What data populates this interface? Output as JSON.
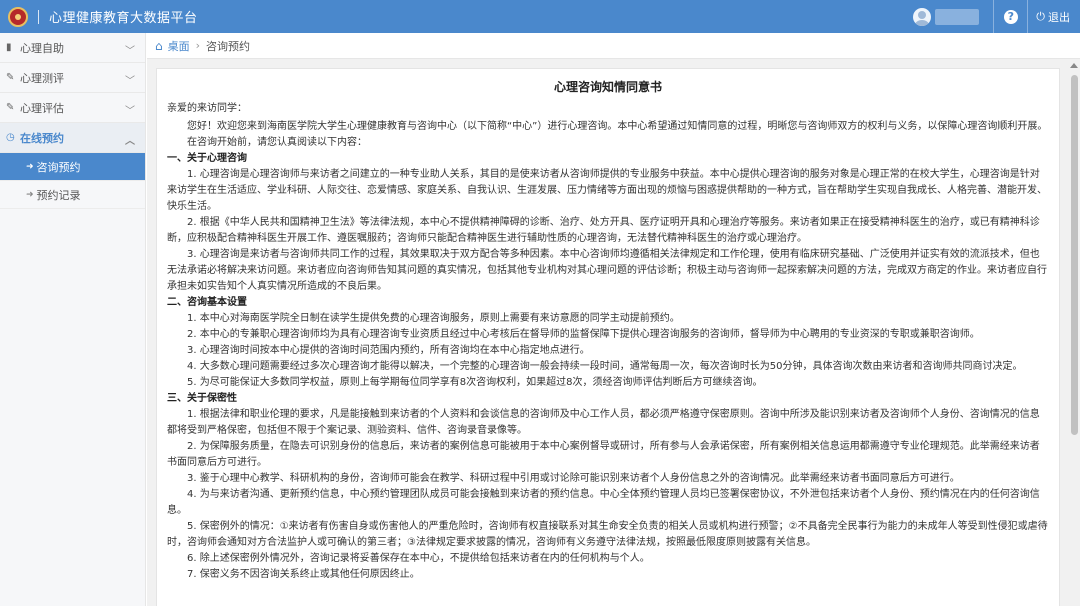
{
  "header": {
    "title": "心理健康教育大数据平台",
    "logout_label": "退出",
    "help_label": "?"
  },
  "sidebar": {
    "items": [
      {
        "label": "心理自助",
        "icon": "book-icon"
      },
      {
        "label": "心理测评",
        "icon": "edit-icon"
      },
      {
        "label": "心理评估",
        "icon": "edit-icon"
      },
      {
        "label": "在线预约",
        "icon": "clock-icon",
        "active": true
      }
    ],
    "subitems": [
      {
        "label": "咨询预约",
        "selected": true
      },
      {
        "label": "预约记录",
        "selected": false
      }
    ]
  },
  "breadcrumb": {
    "home": "桌面",
    "current": "咨询预约"
  },
  "document": {
    "title": "心理咨询知情同意书",
    "salutation": "亲爱的来访同学：",
    "intro1": "您好！欢迎您来到海南医学院大学生心理健康教育与咨询中心（以下简称“中心”）进行心理咨询。本中心希望通过知情同意的过程，明晰您与咨询师双方的权利与义务，以保障心理咨询顺利开展。",
    "intro2": "在咨询开始前，请您认真阅读以下内容：",
    "sec1": "一、关于心理咨询",
    "s1p1": "1. 心理咨询是心理咨询师与来访者之间建立的一种专业助人关系，其目的是使来访者从咨询师提供的专业服务中获益。本中心提供心理咨询的服务对象是心理正常的在校大学生，心理咨询是针对来访学生在生活适应、学业科研、人际交往、恋爱情感、家庭关系、自我认识、生涯发展、压力情绪等方面出现的烦恼与困惑提供帮助的一种方式，旨在帮助学生实现自我成长、人格完善、潜能开发、快乐生活。",
    "s1p2": "2. 根据《中华人民共和国精神卫生法》等法律法规，本中心不提供精神障碍的诊断、治疗、处方开具、医疗证明开具和心理治疗等服务。来访者如果正在接受精神科医生的治疗，或已有精神科诊断，应积极配合精神科医生开展工作、遵医嘱服药；咨询师只能配合精神医生进行辅助性质的心理咨询，无法替代精神科医生的治疗或心理治疗。",
    "s1p3": "3. 心理咨询是来访者与咨询师共同工作的过程，其效果取决于双方配合等多种因素。本中心咨询师均遵循相关法律规定和工作伦理，使用有临床研究基础、广泛使用并证实有效的流派技术，但也无法承诺必将解决来访问题。来访者应向咨询师告知其问题的真实情况，包括其他专业机构对其心理问题的评估诊断；积极主动与咨询师一起探索解决问题的方法，完成双方商定的作业。来访者应自行承担未如实告知个人真实情况所造成的不良后果。",
    "sec2": "二、咨询基本设置",
    "s2p1": "1. 本中心对海南医学院全日制在读学生提供免费的心理咨询服务，原则上需要有来访意愿的同学主动提前预约。",
    "s2p2": "2. 本中心的专兼职心理咨询师均为具有心理咨询专业资质且经过中心考核后在督导师的监督保障下提供心理咨询服务的咨询师，督导师为中心聘用的专业资深的专职或兼职咨询师。",
    "s2p3": "3. 心理咨询时间按本中心提供的咨询时间范围内预约，所有咨询均在本中心指定地点进行。",
    "s2p4": "4. 大多数心理问题需要经过多次心理咨询才能得以解决，一个完整的心理咨询一般会持续一段时间，通常每周一次，每次咨询时长为50分钟，具体咨询次数由来访者和咨询师共同商讨决定。",
    "s2p5": "5. 为尽可能保证大多数同学权益，原则上每学期每位同学享有8次咨询权利，如果超过8次，须经咨询师评估判断后方可继续咨询。",
    "sec3": "三、关于保密性",
    "s3p1": "1. 根据法律和职业伦理的要求，凡是能接触到来访者的个人资料和会谈信息的咨询师及中心工作人员，都必须严格遵守保密原则。咨询中所涉及能识别来访者及咨询师个人身份、咨询情况的信息都将受到严格保密，包括但不限于个案记录、测验资料、信件、咨询录音录像等。",
    "s3p2": "2. 为保障服务质量，在隐去可识别身份的信息后，来访者的案例信息可能被用于本中心案例督导或研讨，所有参与人会承诺保密，所有案例相关信息运用都需遵守专业伦理规范。此举需经来访者书面同意后方可进行。",
    "s3p3": "3. 鉴于心理中心教学、科研机构的身份，咨询师可能会在教学、科研过程中引用或讨论除可能识别来访者个人身份信息之外的咨询情况。此举需经来访者书面同意后方可进行。",
    "s3p4": "4. 为与来访者沟通、更新预约信息，中心预约管理团队成员可能会接触到来访者的预约信息。中心全体预约管理人员均已签署保密协议，不外泄包括来访者个人身份、预约情况在内的任何咨询信息。",
    "s3p5": "5. 保密例外的情况：①来访者有伤害自身或伤害他人的严重危险时，咨询师有权直接联系对其生命安全负责的相关人员或机构进行预警；②不具备完全民事行为能力的未成年人等受到性侵犯或虐待时，咨询师会通知对方合法监护人或可确认的第三者；③法律规定要求披露的情况，咨询师有义务遵守法律法规，按照最低限度原则披露有关信息。",
    "s3p6": "6. 除上述保密例外情况外，咨询记录将妥善保存在本中心，不提供给包括来访者在内的任何机构与个人。",
    "s3p7": "7. 保密义务不因咨询关系终止或其他任何原因终止。"
  }
}
